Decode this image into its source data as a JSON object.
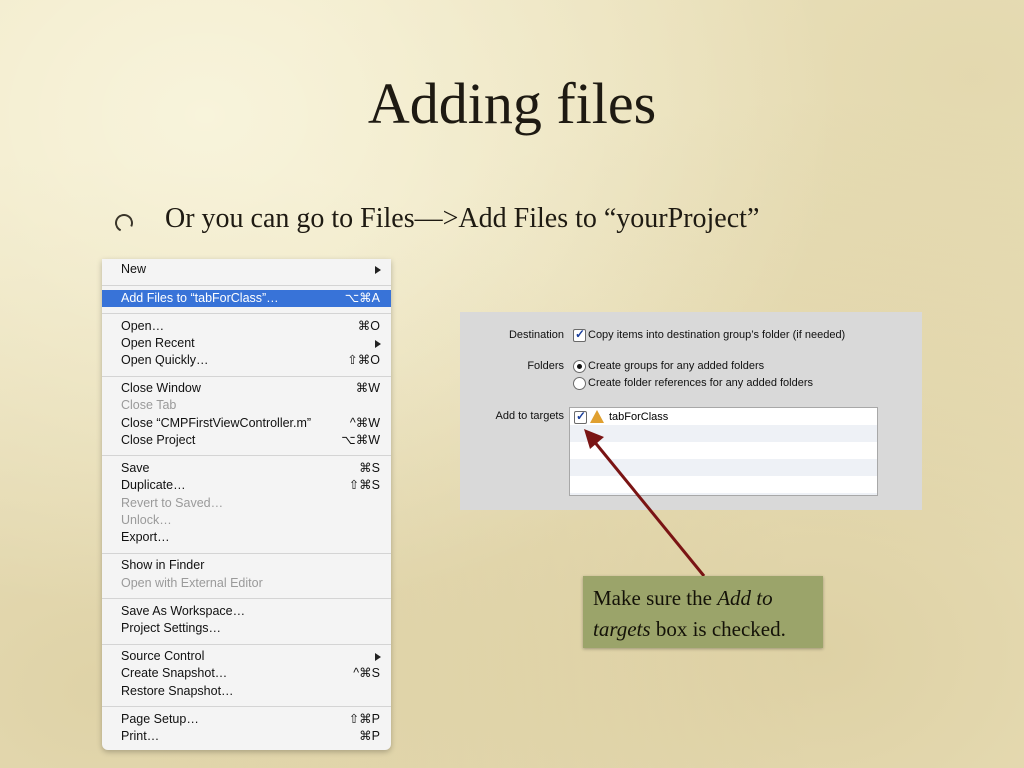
{
  "slide": {
    "title": "Adding files",
    "bullet": "Or you can go to Files—>Add Files to “yourProject”"
  },
  "file_menu": {
    "items": [
      {
        "label": "New",
        "shortcut": "",
        "submenu": true,
        "disabled": false
      },
      {
        "label": "Add Files to “tabForClass”…",
        "shortcut": "⌥⌘A",
        "highlighted": true
      },
      {
        "label": "Open…",
        "shortcut": "⌘O"
      },
      {
        "label": "Open Recent",
        "shortcut": "",
        "submenu": true
      },
      {
        "label": "Open Quickly…",
        "shortcut": "⇧⌘O"
      },
      {
        "label": "Close Window",
        "shortcut": "⌘W"
      },
      {
        "label": "Close Tab",
        "shortcut": "",
        "disabled": true
      },
      {
        "label": "Close “CMPFirstViewController.m”",
        "shortcut": "^⌘W"
      },
      {
        "label": "Close Project",
        "shortcut": "⌥⌘W"
      },
      {
        "label": "Save",
        "shortcut": "⌘S"
      },
      {
        "label": "Duplicate…",
        "shortcut": "⇧⌘S"
      },
      {
        "label": "Revert to Saved…",
        "shortcut": "",
        "disabled": true
      },
      {
        "label": "Unlock…",
        "shortcut": "",
        "disabled": true
      },
      {
        "label": "Export…",
        "shortcut": ""
      },
      {
        "label": "Show in Finder",
        "shortcut": ""
      },
      {
        "label": "Open with External Editor",
        "shortcut": "",
        "disabled": true
      },
      {
        "label": "Save As Workspace…",
        "shortcut": ""
      },
      {
        "label": "Project Settings…",
        "shortcut": ""
      },
      {
        "label": "Source Control",
        "shortcut": "",
        "submenu": true
      },
      {
        "label": "Create Snapshot…",
        "shortcut": "^⌘S"
      },
      {
        "label": "Restore Snapshot…",
        "shortcut": ""
      },
      {
        "label": "Page Setup…",
        "shortcut": "⇧⌘P"
      },
      {
        "label": "Print…",
        "shortcut": "⌘P"
      }
    ]
  },
  "dialog": {
    "destination_label": "Destination",
    "copy_items_label": "Copy items into destination group’s folder (if needed)",
    "copy_items_checked": true,
    "folders_label": "Folders",
    "folder_option_groups": "Create groups for any added folders",
    "folder_option_references": "Create folder references for any added folders",
    "folder_selected": "groups",
    "targets_label": "Add to targets",
    "targets": [
      {
        "name": "tabForClass",
        "checked": true
      }
    ]
  },
  "callout": {
    "line1_prefix": "Make sure the ",
    "line1_emph": "Add to",
    "line2_emph": "targets",
    "line2_suffix": " box is checked."
  },
  "colors": {
    "menu_highlight": "#3873d8",
    "callout_bg": "#9ba46a",
    "arrow": "#7a1414"
  },
  "icons": {
    "bullet": "hollow-circle-bullet",
    "submenu": "submenu-arrow-icon",
    "target": "app-target-icon"
  }
}
